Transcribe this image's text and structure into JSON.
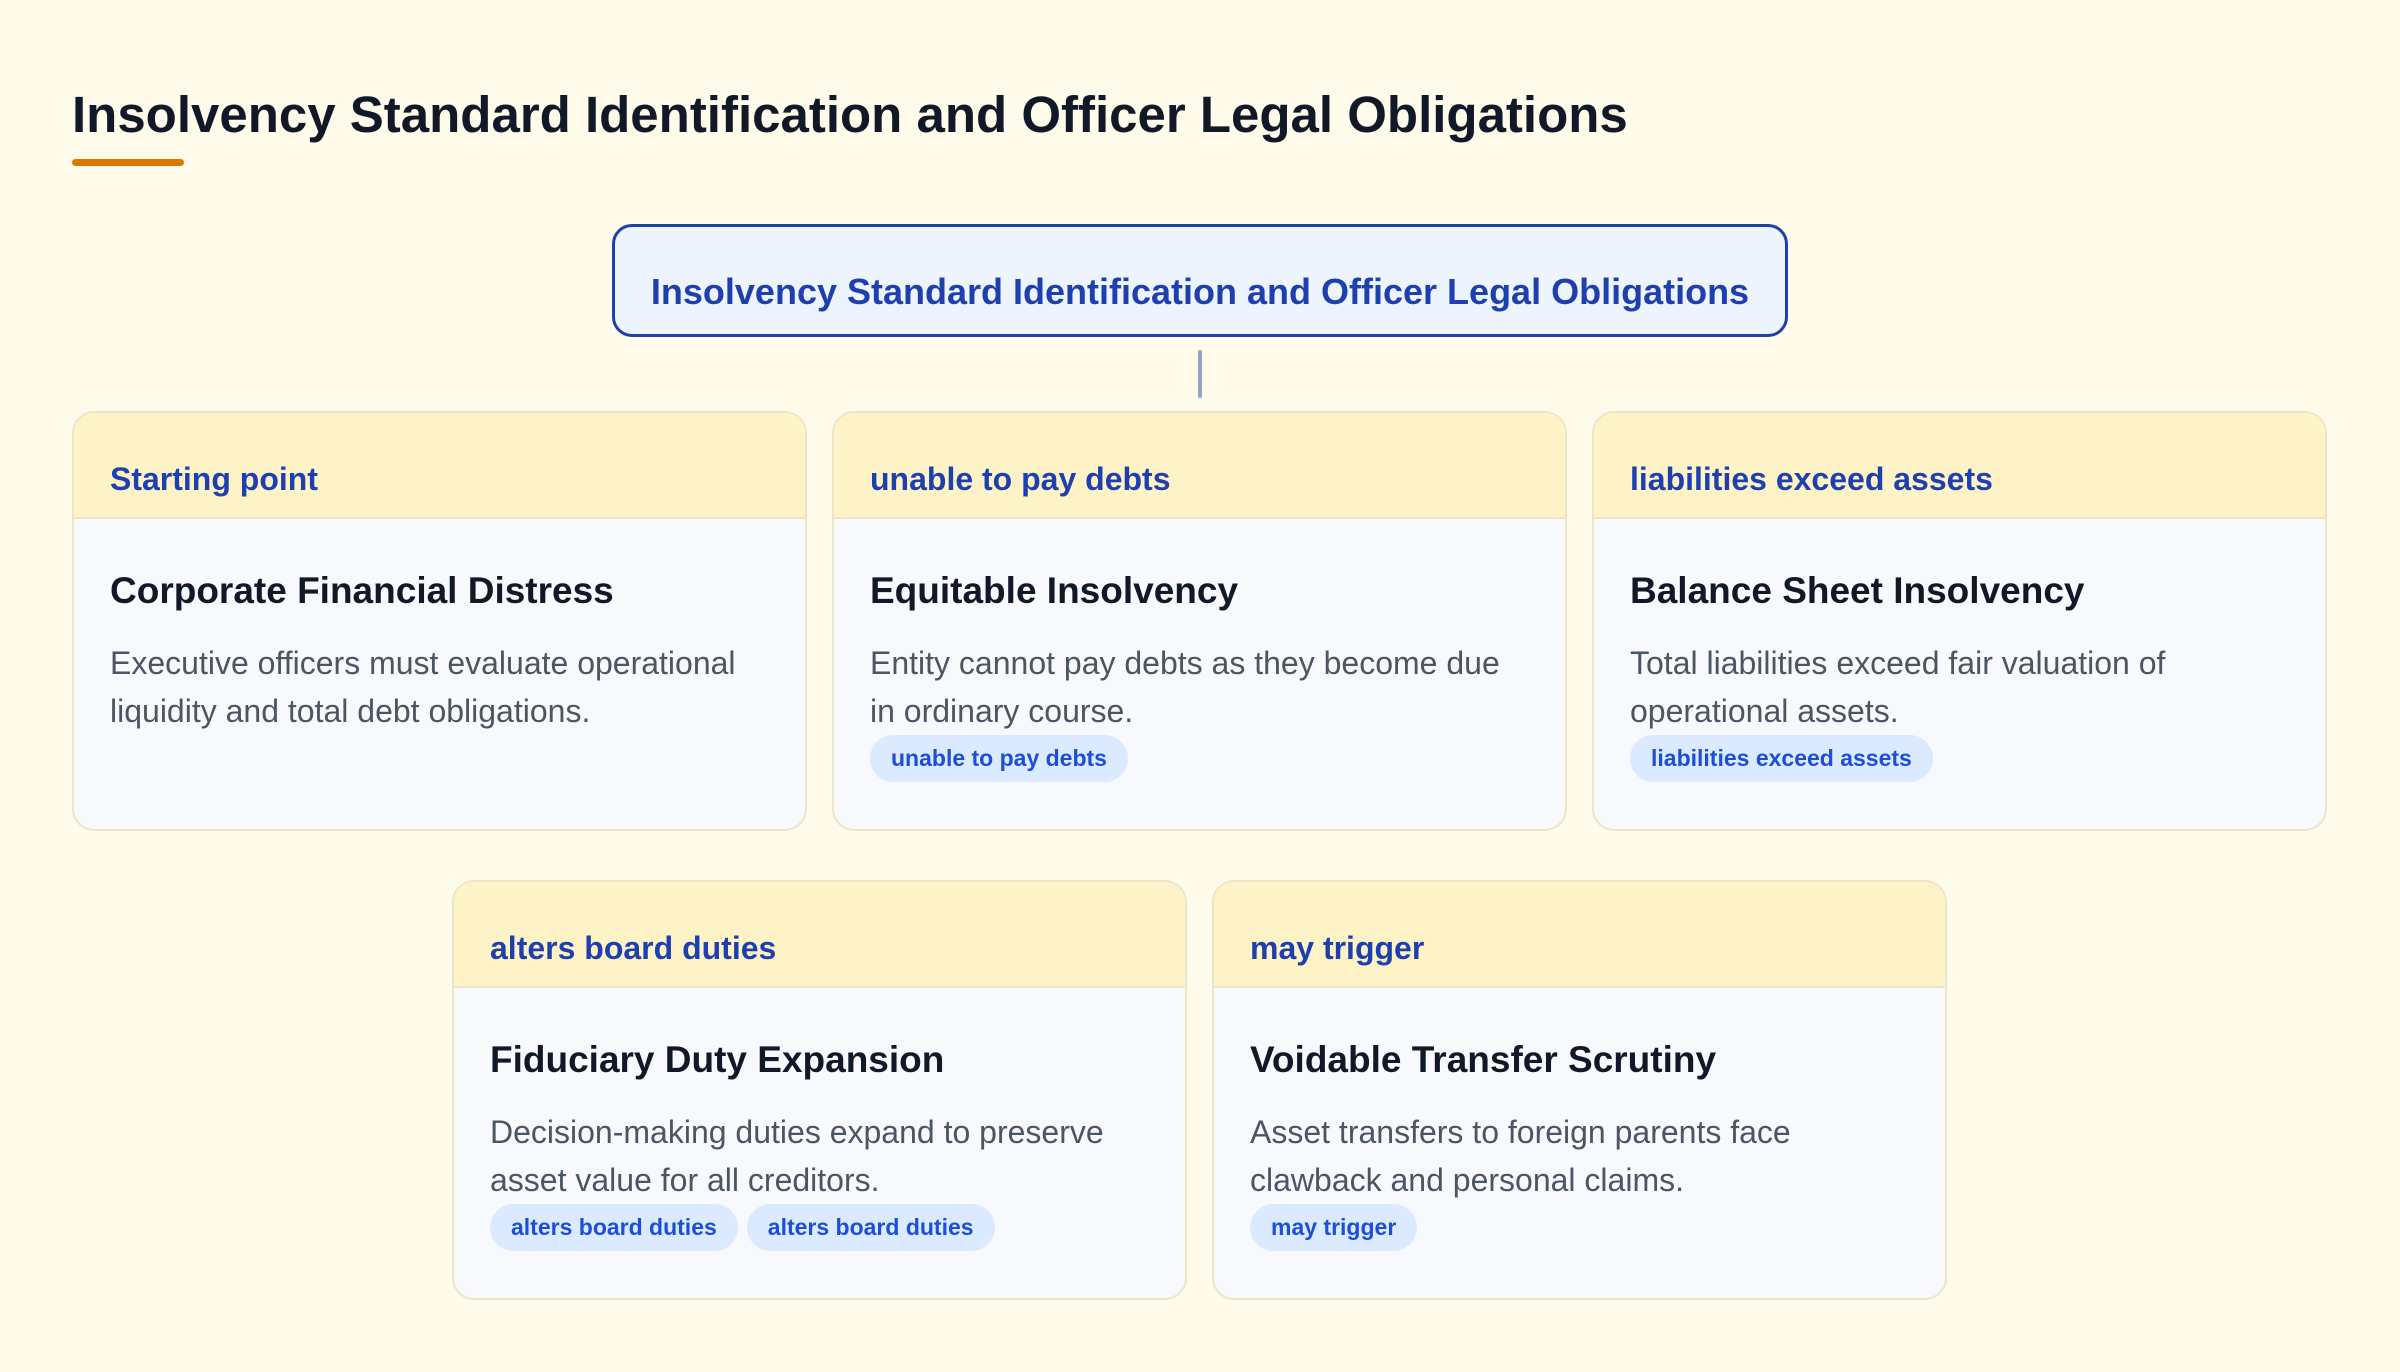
{
  "header": {
    "title": "Insolvency Standard Identification and Officer Legal Obligations"
  },
  "diagram": {
    "root": {
      "label": "Insolvency Standard Identification and Officer Legal Obligations"
    },
    "cards": [
      {
        "tag": "Starting point",
        "title": "Corporate Financial Distress",
        "description": "Executive officers must evaluate operational liquidity and total debt obligations.",
        "chips": []
      },
      {
        "tag": "unable to pay debts",
        "title": "Equitable Insolvency",
        "description": "Entity cannot pay debts as they become due in ordinary course.",
        "chips": [
          "unable to pay debts"
        ]
      },
      {
        "tag": "liabilities exceed assets",
        "title": "Balance Sheet Insolvency",
        "description": "Total liabilities exceed fair valuation of operational assets.",
        "chips": [
          "liabilities exceed assets"
        ]
      },
      {
        "tag": "alters board duties",
        "title": "Fiduciary Duty Expansion",
        "description": "Decision-making duties expand to preserve asset value for all creditors.",
        "chips": [
          "alters board duties",
          "alters board duties"
        ]
      },
      {
        "tag": "may trigger",
        "title": "Voidable Transfer Scrutiny",
        "description": "Asset transfers to foreign parents face clawback and personal claims.",
        "chips": [
          "may trigger"
        ]
      }
    ]
  },
  "colors": {
    "background": "#fefbea",
    "accent": "#d97706",
    "primary": "#1e40af",
    "card_header": "#fef3c7",
    "chip_bg": "#dbeafe",
    "chip_text": "#1d4ed8"
  }
}
